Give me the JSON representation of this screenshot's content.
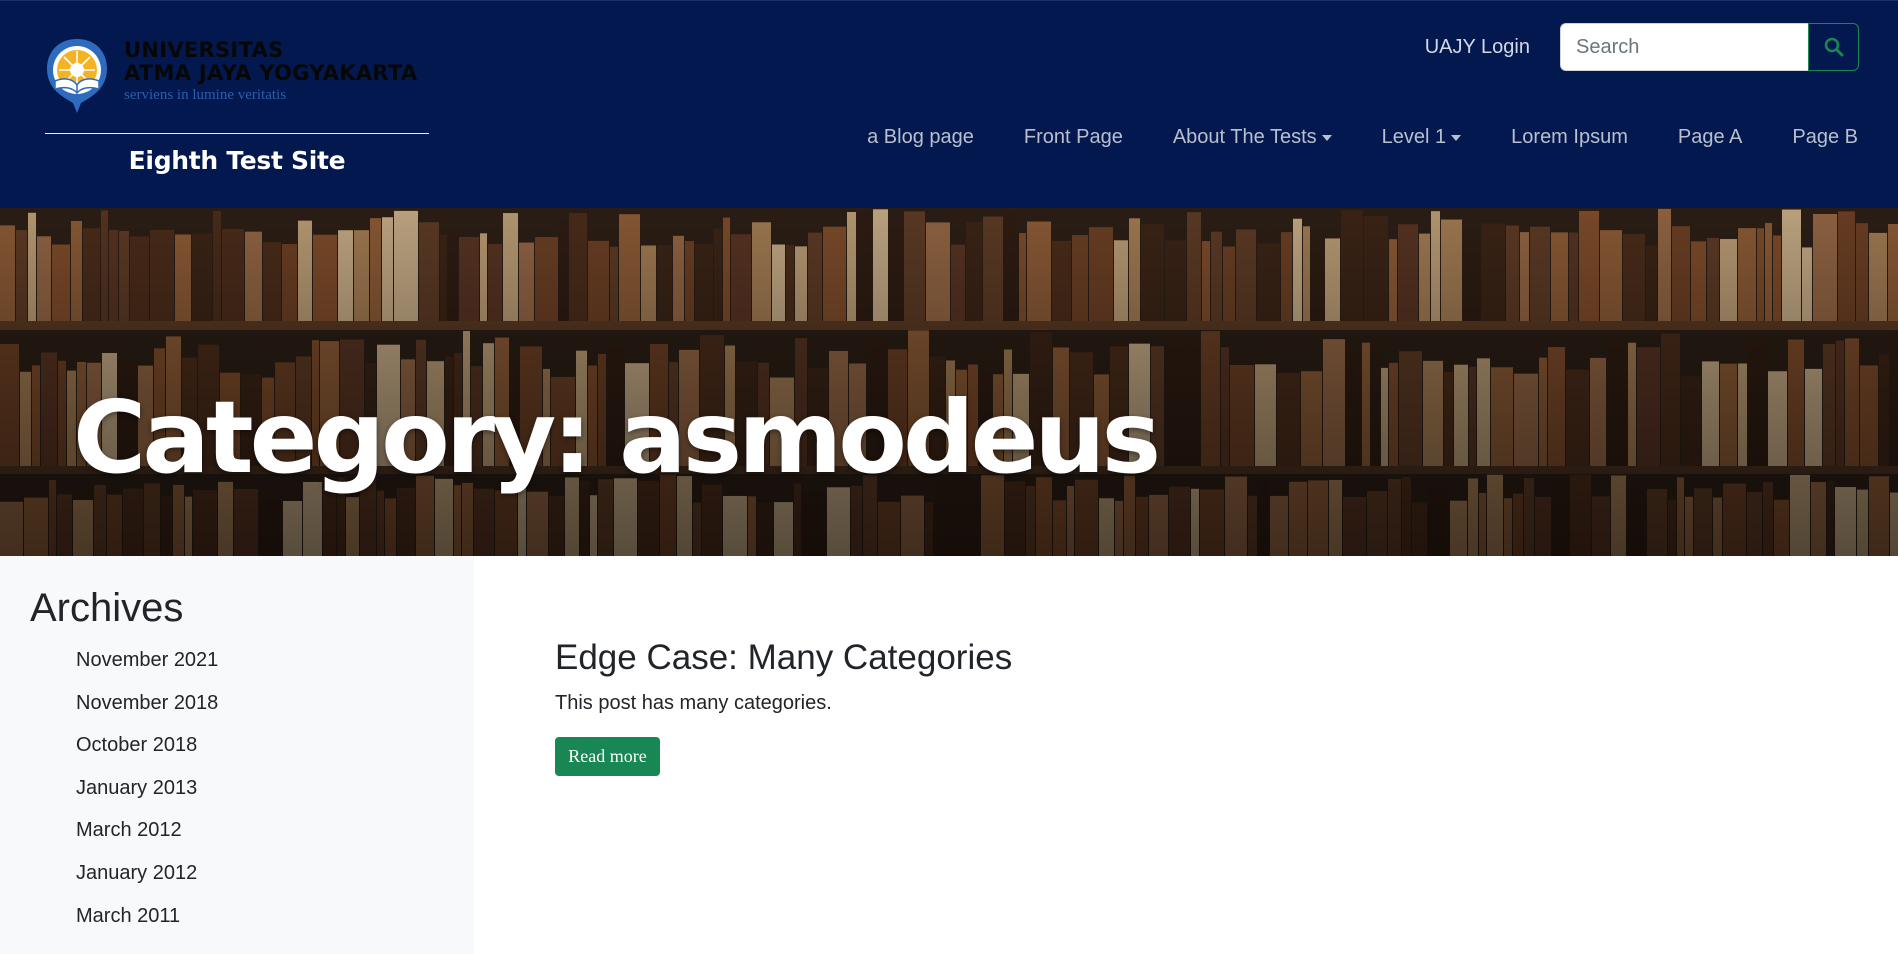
{
  "header": {
    "logo": {
      "line1": "UNIVERSITAS",
      "line2": "ATMA JAYA YOGYAKARTA",
      "motto": "serviens in lumine veritatis"
    },
    "site_title": "Eighth Test Site",
    "login_label": "UAJY Login",
    "search": {
      "placeholder": "Search",
      "value": ""
    },
    "nav": [
      {
        "label": "a Blog page",
        "dropdown": false
      },
      {
        "label": "Front Page",
        "dropdown": false
      },
      {
        "label": "About The Tests",
        "dropdown": true
      },
      {
        "label": "Level 1",
        "dropdown": true
      },
      {
        "label": "Lorem Ipsum",
        "dropdown": false
      },
      {
        "label": "Page A",
        "dropdown": false
      },
      {
        "label": "Page B",
        "dropdown": false
      }
    ]
  },
  "hero": {
    "title": "Category: asmodeus"
  },
  "sidebar": {
    "heading": "Archives",
    "items": [
      "November 2021",
      "November 2018",
      "October 2018",
      "January 2013",
      "March 2012",
      "January 2012",
      "March 2011"
    ]
  },
  "main": {
    "post": {
      "title": "Edge Case: Many Categories",
      "excerpt": "This post has many categories.",
      "button_label": "Read more"
    }
  },
  "colors": {
    "header_bg": "#02184f",
    "accent_green": "#198754",
    "sidebar_bg": "#f8f9fa"
  },
  "icons": {
    "search": "search-icon",
    "logo": "university-seal-icon"
  }
}
